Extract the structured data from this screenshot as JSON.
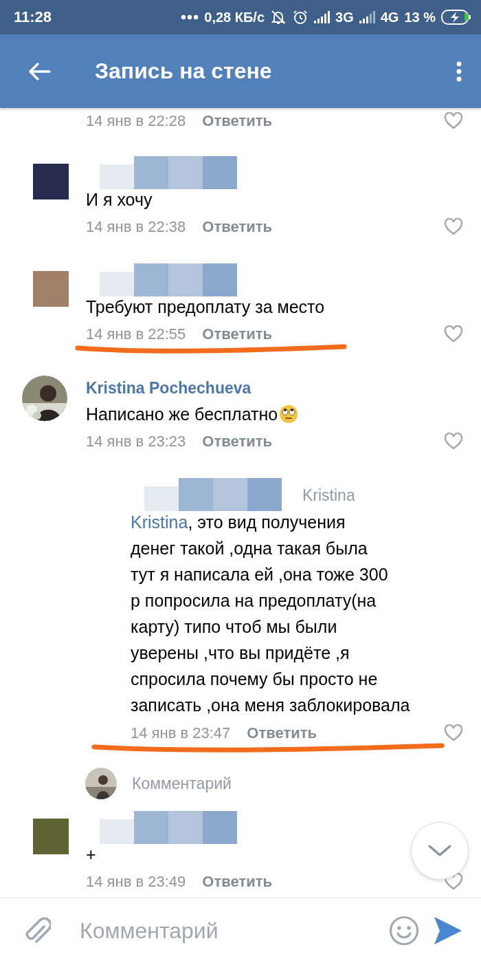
{
  "status_bar": {
    "time": "11:28",
    "speed": "0,28 КБ/с",
    "network_1": "3G",
    "network_2": "4G",
    "battery": "13 %"
  },
  "header": {
    "title": "Запись на стене"
  },
  "comments": [
    {
      "kind": "partial",
      "time": "14 янв в 22:28",
      "reply": "Ответить",
      "liked": false,
      "marked": false
    },
    {
      "kind": "comment",
      "author_redacted": true,
      "avatar": {
        "kind": "censored",
        "color": "#262b50"
      },
      "text": "И я хочу",
      "time": "14 янв в 22:38",
      "reply": "Ответить",
      "liked": false,
      "marked": false
    },
    {
      "kind": "comment",
      "author_redacted": true,
      "avatar": {
        "kind": "censored",
        "color": "#a3806a"
      },
      "text": "Требуют предоплату за место",
      "time": "14 янв в 22:55",
      "reply": "Ответить",
      "liked": false,
      "marked": true
    },
    {
      "kind": "comment",
      "author": "Kristina Pochechueva",
      "author_redacted": false,
      "text": "Написано же бесплатно",
      "emoji": true,
      "time": "14 янв в 23:23",
      "reply": "Ответить",
      "liked": false,
      "marked": false
    },
    {
      "kind": "reply",
      "author_redacted": true,
      "reply_to": "Kristina",
      "mention": "Kristina",
      "text": ", это вид получения\nденег такой ,одна такая была\nтут я написала ей ,она тоже 300\nр попросила на предоплату(на\nкарту) типо чтоб мы были\nуверены ,что вы придёте ,я\nспросила почему бы просто не\nзаписать ,она меня заблокировала",
      "time": "14 янв в 23:47",
      "reply": "Ответить",
      "liked": false,
      "marked": true
    },
    {
      "kind": "thread_input",
      "placeholder": "Комментарий"
    },
    {
      "kind": "comment",
      "author_redacted": true,
      "avatar": {
        "kind": "censored",
        "color": "#5e6235"
      },
      "text": "+",
      "time": "14 янв в 23:49",
      "reply": "Ответить",
      "liked": false,
      "marked": false
    }
  ],
  "composer": {
    "placeholder": "Комментарий"
  }
}
